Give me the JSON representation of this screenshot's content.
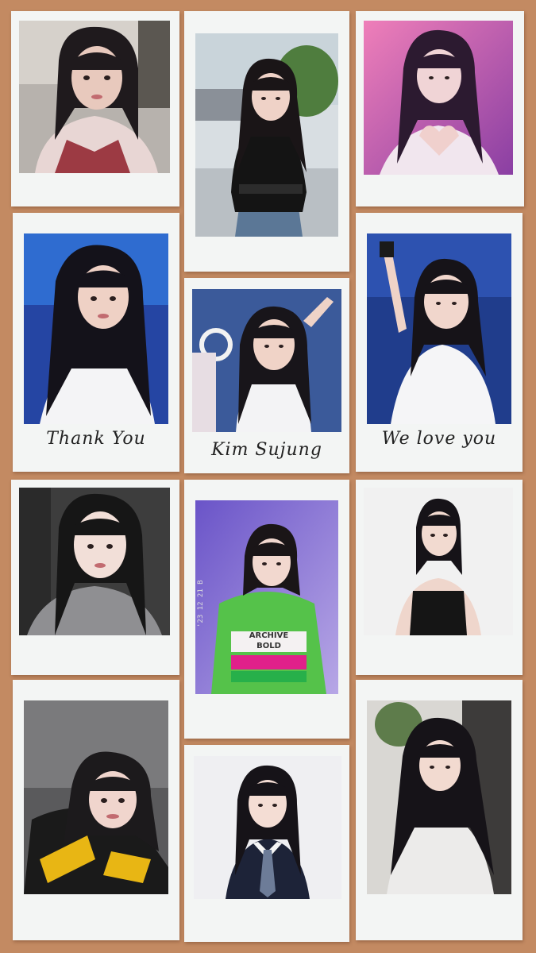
{
  "captions": {
    "left": "Thank You",
    "center": "Kim Sujung",
    "right": "We love you"
  },
  "photos": [
    {
      "subject": "selfie in pink knit sweater"
    },
    {
      "subject": "black top and denim skirt by window"
    },
    {
      "subject": "stage heart hands in white dress"
    },
    {
      "subject": "white crop top on blue stage"
    },
    {
      "subject": "white top performing on stage"
    },
    {
      "subject": "white sleeveless top, arm raised"
    },
    {
      "subject": "selfie in grey knit"
    },
    {
      "subject": "green ARCHIVE BOLD sweater"
    },
    {
      "subject": "black camisole on white background"
    },
    {
      "subject": "selfie in black and yellow jacket"
    },
    {
      "subject": "school uniform with tie"
    },
    {
      "subject": "grey top with scarf, wavy hair"
    }
  ],
  "sweater_text": "ARCHIVE BOLD",
  "stamp_text": "'23 12 21 B",
  "colors": {
    "background": "#c38a62",
    "frame": "#f3f5f4"
  }
}
